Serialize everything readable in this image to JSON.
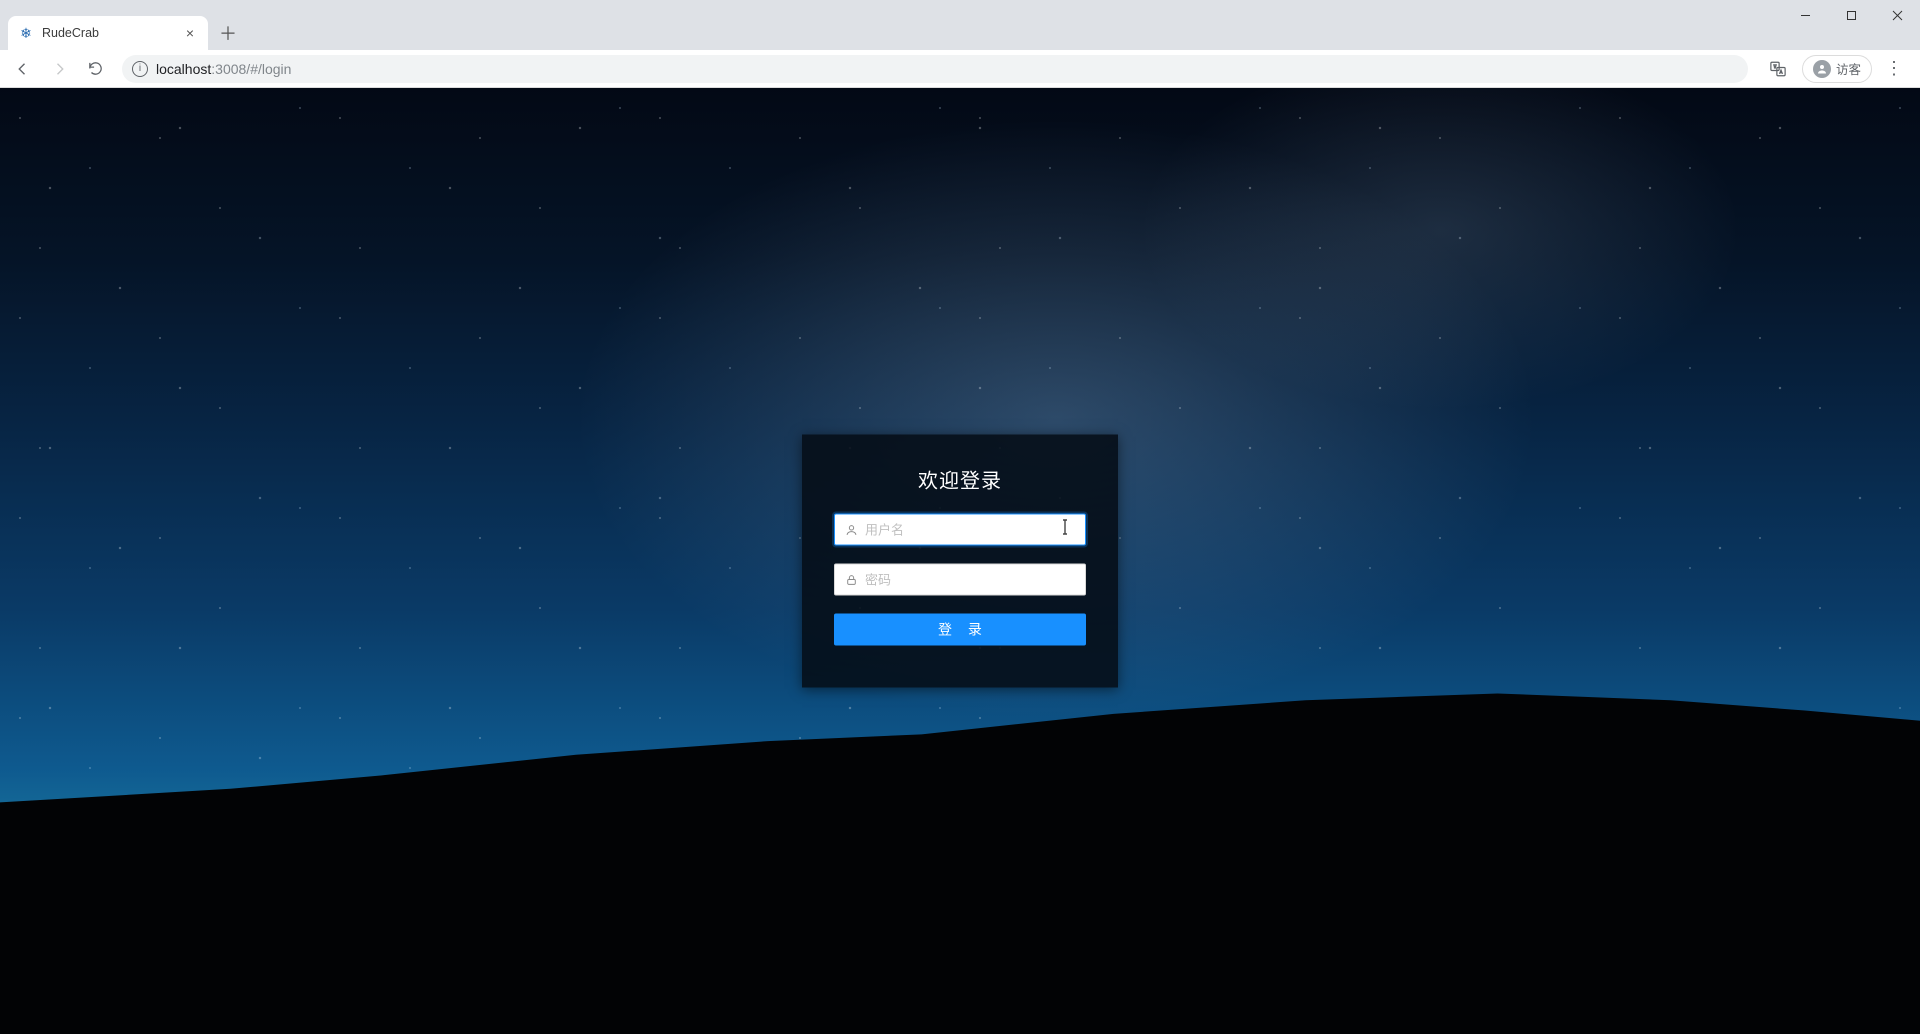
{
  "browser": {
    "tab": {
      "title": "RudeCrab",
      "favicon": "❄"
    },
    "window_controls": {
      "minimize": "minimize",
      "maximize": "maximize",
      "close": "close"
    },
    "nav": {
      "back": "back",
      "forward": "forward",
      "reload": "reload"
    },
    "address": {
      "host": "localhost",
      "rest": ":3008/#/login"
    },
    "translate_icon_tip": "translate",
    "profile_label": "访客",
    "menu_tip": "menu"
  },
  "login": {
    "title": "欢迎登录",
    "username": {
      "value": "",
      "placeholder": "用户名"
    },
    "password": {
      "value": "",
      "placeholder": "密码"
    },
    "submit_label": "登 录"
  },
  "colors": {
    "primary": "#1890ff"
  }
}
